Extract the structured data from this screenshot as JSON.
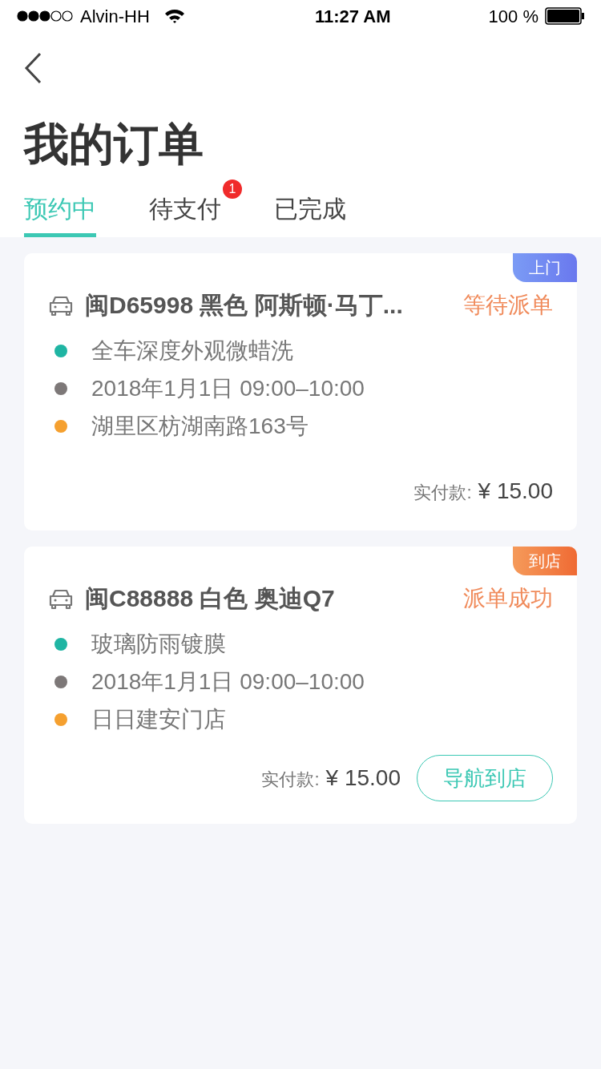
{
  "status_bar": {
    "carrier": "Alvin-HH",
    "time": "11:27 AM",
    "battery": "100 %"
  },
  "title": "我的订单",
  "tabs": [
    {
      "label": "预约中",
      "selected": true
    },
    {
      "label": "待支付",
      "selected": false,
      "badge": "1"
    },
    {
      "label": "已完成",
      "selected": false
    }
  ],
  "orders": [
    {
      "tag": {
        "kind": "home",
        "label": "上门"
      },
      "car": "闽D65998 黑色 阿斯顿·马丁...",
      "status": "等待派单",
      "details": [
        {
          "text": "全车深度外观微蜡洗",
          "color": "#1fb5a3"
        },
        {
          "text": "2018年1月1日 09:00–10:00",
          "color": "#7d7878"
        },
        {
          "text": "湖里区枋湖南路163号",
          "color": "#f5a02f"
        }
      ],
      "price_label": "实付款:",
      "price": "¥ 15.00"
    },
    {
      "tag": {
        "kind": "store",
        "label": "到店"
      },
      "car": "闽C88888 白色 奥迪Q7",
      "status": "派单成功",
      "details": [
        {
          "text": "玻璃防雨镀膜",
          "color": "#1fb5a3"
        },
        {
          "text": "2018年1月1日 09:00–10:00",
          "color": "#7d7878"
        },
        {
          "text": "日日建安门店",
          "color": "#f5a02f"
        }
      ],
      "price_label": "实付款:",
      "price": "¥ 15.00",
      "button": "导航到店"
    }
  ]
}
